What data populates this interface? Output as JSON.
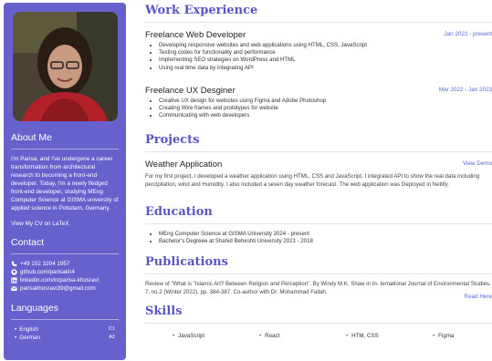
{
  "sidebar": {
    "about": {
      "heading": "About Me",
      "text": "I'm Parisa, and I've undergone a career transformation from architectural research to becoming a front-end developer. Today, I'm a newly fledged front-end developer, studying MEng Computer Science at GISMA university of applied science in Potsdam, Germany.",
      "cv_link": "View My CV on LaTeX"
    },
    "contact": {
      "heading": "Contact",
      "items": [
        {
          "icon": "phone-icon",
          "text": "+49 152 3204 1957"
        },
        {
          "icon": "github-icon",
          "text": "github.com/parisakh4"
        },
        {
          "icon": "linkedin-icon",
          "text": "linkedin.com/in/parisa-khosravi"
        },
        {
          "icon": "mail-icon",
          "text": "parisakhosravi39@gmail.com"
        }
      ]
    },
    "languages": {
      "heading": "Languages",
      "items": [
        {
          "name": "English",
          "level": "C1"
        },
        {
          "name": "German",
          "level": "A2"
        }
      ]
    }
  },
  "main": {
    "experience": {
      "heading": "Work Experience",
      "jobs": [
        {
          "title": "Freelance Web Developer",
          "date": "Jan 2023 - present",
          "bullets": [
            "Developing responsive websites and web applications using HTML, CSS, JavaScript",
            "Testing codes for functionality and performance",
            "Implementing SEO strategies on WordPress and HTML",
            "Using real time data by integrating API"
          ]
        },
        {
          "title": "Freelance UX Desginer",
          "date": "Mar 2022 - Jan 2023",
          "bullets": [
            "Creative UX design for websites using Figma and Adobe Photoshop",
            "Creating Wire frames and prototypes for website",
            "Communicating with web developers"
          ]
        }
      ]
    },
    "projects": {
      "heading": "Projects",
      "title": "Weather Application",
      "link": "View Demo",
      "text": "For my first project, I developed a weather application using HTML, CSS and JavaScript. I integrated API to show the real data including percipitation, wind and Humidity. I also included a seven day weather forecast. The web application was Deployed in Netlify."
    },
    "education": {
      "heading": "Education",
      "items": [
        "MEng Computer Science at GISMA University 2024 - present",
        "Bachelor's Degreee at Shahid Beheshti University 2021 - 2018"
      ]
    },
    "publications": {
      "heading": "Publications",
      "text": "Review of \"What is \"Islamic Art? Between Religion and Perception\". By Windy M.K. Shaw in In- ternational Journal of Environmental Studies, 7, no.2 (Winter 2022), pp. 384-387. Co-author with Dr. Mohammad Fallah.",
      "link": "Read Here"
    },
    "skills": {
      "heading": "Skills",
      "items": [
        "JavaScript",
        "React",
        "HTM, CSS",
        "Figma"
      ]
    }
  },
  "colors": {
    "sidebar": "#6661cc",
    "heading": "#5a55c2",
    "link": "#5a6ad8"
  }
}
